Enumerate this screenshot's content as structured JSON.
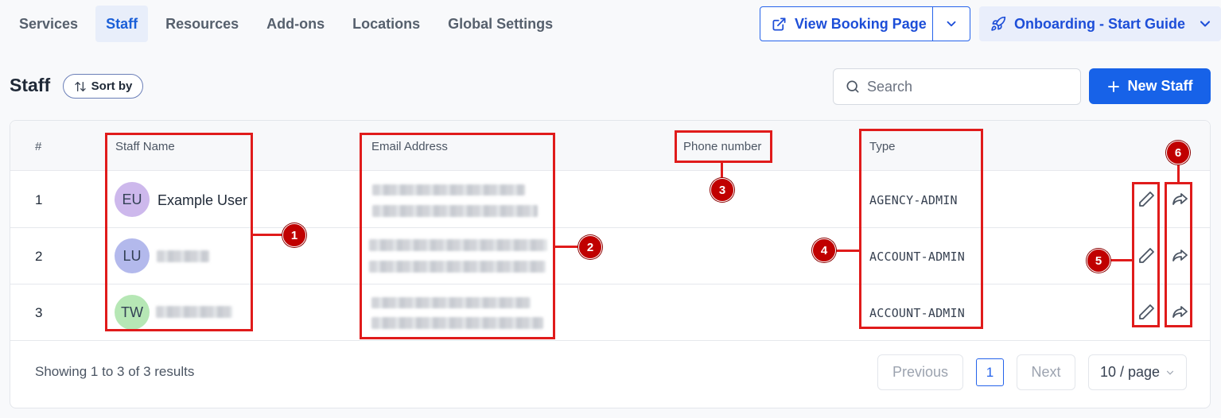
{
  "nav": {
    "tabs": [
      {
        "label": "Services"
      },
      {
        "label": "Staff"
      },
      {
        "label": "Resources"
      },
      {
        "label": "Add-ons"
      },
      {
        "label": "Locations"
      },
      {
        "label": "Global Settings"
      }
    ],
    "active_tab": "Staff",
    "view_booking_label": "View Booking Page",
    "onboarding_label": "Onboarding - Start Guide"
  },
  "header": {
    "title": "Staff",
    "sort_label": "Sort by",
    "search_placeholder": "Search",
    "new_button_label": "New Staff"
  },
  "table": {
    "columns": [
      "#",
      "Staff Name",
      "Email Address",
      "Phone number",
      "Type"
    ],
    "rows": [
      {
        "index": "1",
        "initials": "EU",
        "avatar_color": "#cdb8ec",
        "name": "Example User",
        "type": "AGENCY-ADMIN"
      },
      {
        "index": "2",
        "initials": "LU",
        "avatar_color": "#b3b9ec",
        "name": "",
        "type": "ACCOUNT-ADMIN"
      },
      {
        "index": "3",
        "initials": "TW",
        "avatar_color": "#b6e7b5",
        "name": "",
        "type": "ACCOUNT-ADMIN"
      }
    ]
  },
  "footer": {
    "summary": "Showing 1 to 3 of 3 results",
    "previous_label": "Previous",
    "current_page": "1",
    "next_label": "Next",
    "page_size_label": "10 / page"
  },
  "annotations": {
    "markers": [
      "1",
      "2",
      "3",
      "4",
      "5",
      "6"
    ]
  },
  "colors": {
    "accent": "#1762e8",
    "annotation": "#e01b1b"
  }
}
